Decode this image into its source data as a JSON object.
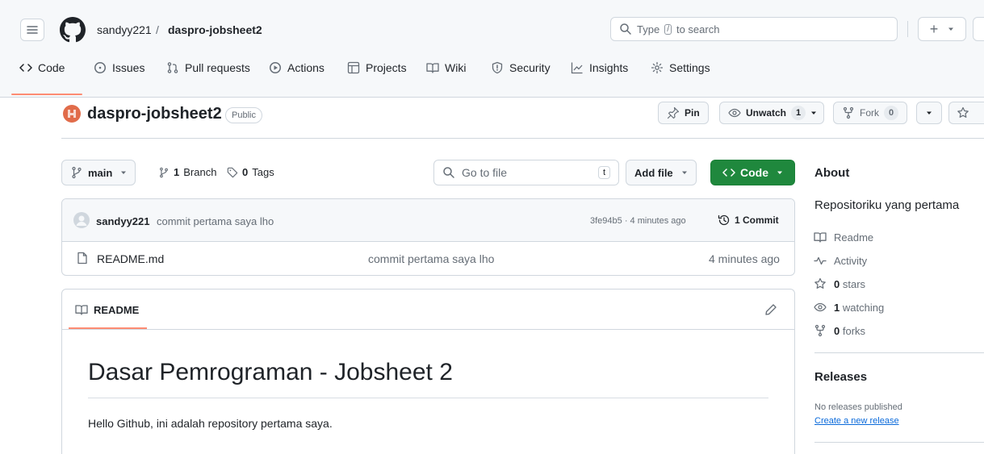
{
  "header": {
    "owner": "sandyy221",
    "separator": "/",
    "repo": "daspro-jobsheet2",
    "search_prefix": "Type",
    "search_key": "/",
    "search_suffix": "to search",
    "plus_label": "+"
  },
  "nav": {
    "code": "Code",
    "issues": "Issues",
    "pulls": "Pull requests",
    "actions": "Actions",
    "projects": "Projects",
    "wiki": "Wiki",
    "security": "Security",
    "insights": "Insights",
    "settings": "Settings"
  },
  "repo": {
    "name": "daspro-jobsheet2",
    "visibility": "Public",
    "pin_label": "Pin",
    "unwatch_label": "Unwatch",
    "watch_count": "1",
    "fork_label": "Fork",
    "fork_count": "0"
  },
  "toolbar": {
    "branch": "main",
    "branch_count": "1",
    "branch_word": "Branch",
    "tag_count": "0",
    "tag_word": "Tags",
    "goto_placeholder": "Go to file",
    "goto_key": "t",
    "add_file": "Add file",
    "code_button": "Code"
  },
  "latest_commit": {
    "author": "sandyy221",
    "message": "commit pertama saya lho",
    "sha_time": "3fe94b5 · 4 minutes ago",
    "commit_count_label": "1 Commit"
  },
  "files": [
    {
      "name": "README.md",
      "message": "commit pertama saya lho",
      "time": "4 minutes ago"
    }
  ],
  "readme": {
    "tab_label": "README",
    "heading": "Dasar Pemrograman - Jobsheet 2",
    "paragraph": "Hello Github, ini adalah repository pertama saya."
  },
  "about": {
    "title": "About",
    "description": "Repositoriku yang pertama",
    "readme": "Readme",
    "activity": "Activity",
    "stars_count": "0",
    "stars_word": "stars",
    "watching_count": "1",
    "watching_word": "watching",
    "forks_count": "0",
    "forks_word": "forks"
  },
  "releases": {
    "title": "Releases",
    "none": "No releases published",
    "create_link": "Create a new release"
  },
  "colors": {
    "accent_green": "#1f883d",
    "link_blue": "#0969da",
    "underline_orange": "#fd8c73"
  }
}
